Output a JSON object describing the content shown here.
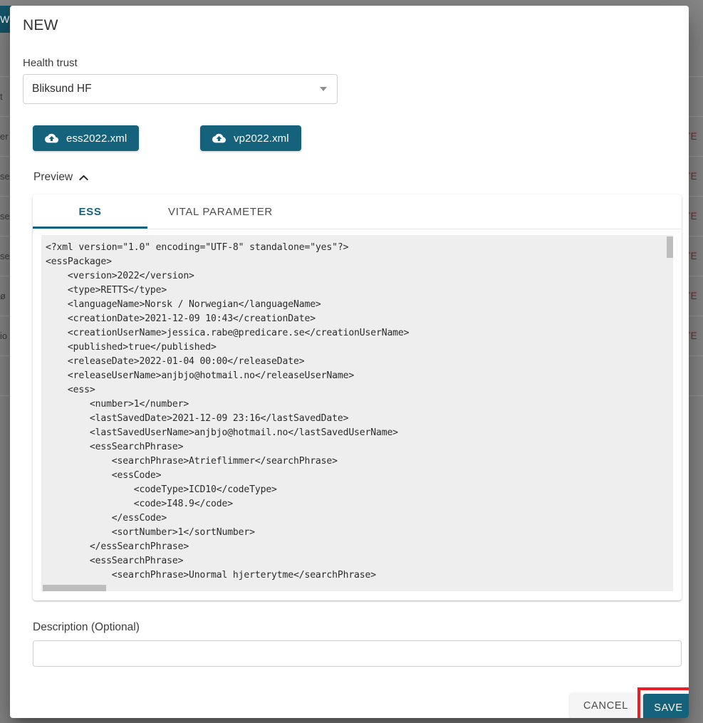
{
  "background": {
    "new_button_label": "NEW",
    "left_row_fragments": [
      "",
      "t",
      "er",
      "se",
      "se",
      "se",
      "ø",
      "io",
      ""
    ],
    "right_row_fragments": [
      "",
      "",
      "TE",
      "TE",
      "TE",
      "TE",
      "TE",
      "TE",
      ""
    ]
  },
  "dialog": {
    "title": "NEW",
    "health_trust": {
      "label": "Health trust",
      "selected": "Bliksund HF"
    },
    "uploads": [
      {
        "label": "ess2022.xml",
        "icon": "cloud-upload-icon"
      },
      {
        "label": "vp2022.xml",
        "icon": "cloud-upload-icon"
      }
    ],
    "preview": {
      "toggle_label": "Preview",
      "toggle_icon": "chevron-up-icon",
      "tabs": [
        {
          "id": "ess",
          "label": "ESS",
          "active": true
        },
        {
          "id": "vital",
          "label": "VITAL PARAMETER",
          "active": false
        }
      ],
      "code": "<?xml version=\"1.0\" encoding=\"UTF-8\" standalone=\"yes\"?>\n<essPackage>\n    <version>2022</version>\n    <type>RETTS</type>\n    <languageName>Norsk / Norwegian</languageName>\n    <creationDate>2021-12-09 10:43</creationDate>\n    <creationUserName>jessica.rabe@predicare.se</creationUserName>\n    <published>true</published>\n    <releaseDate>2022-01-04 00:00</releaseDate>\n    <releaseUserName>anjbjo@hotmail.no</releaseUserName>\n    <ess>\n        <number>1</number>\n        <lastSavedDate>2021-12-09 23:16</lastSavedDate>\n        <lastSavedUserName>anjbjo@hotmail.no</lastSavedUserName>\n        <essSearchPhrase>\n            <searchPhrase>Atrieflimmer</searchPhrase>\n            <essCode>\n                <codeType>ICD10</codeType>\n                <code>I48.9</code>\n            </essCode>\n            <sortNumber>1</sortNumber>\n        </essSearchPhrase>\n        <essSearchPhrase>\n            <searchPhrase>Unormal hjerterytme</searchPhrase>\n            <essCode>"
    },
    "description": {
      "label": "Description (Optional)",
      "value": "",
      "placeholder": ""
    },
    "footer": {
      "cancel_label": "CANCEL",
      "save_label": "SAVE"
    }
  },
  "colors": {
    "accent_teal": "#14627c",
    "highlight_red": "#ee1c25",
    "backdrop": "#878787",
    "code_bg": "#eeeeee",
    "delete_text": "#8d2230"
  }
}
